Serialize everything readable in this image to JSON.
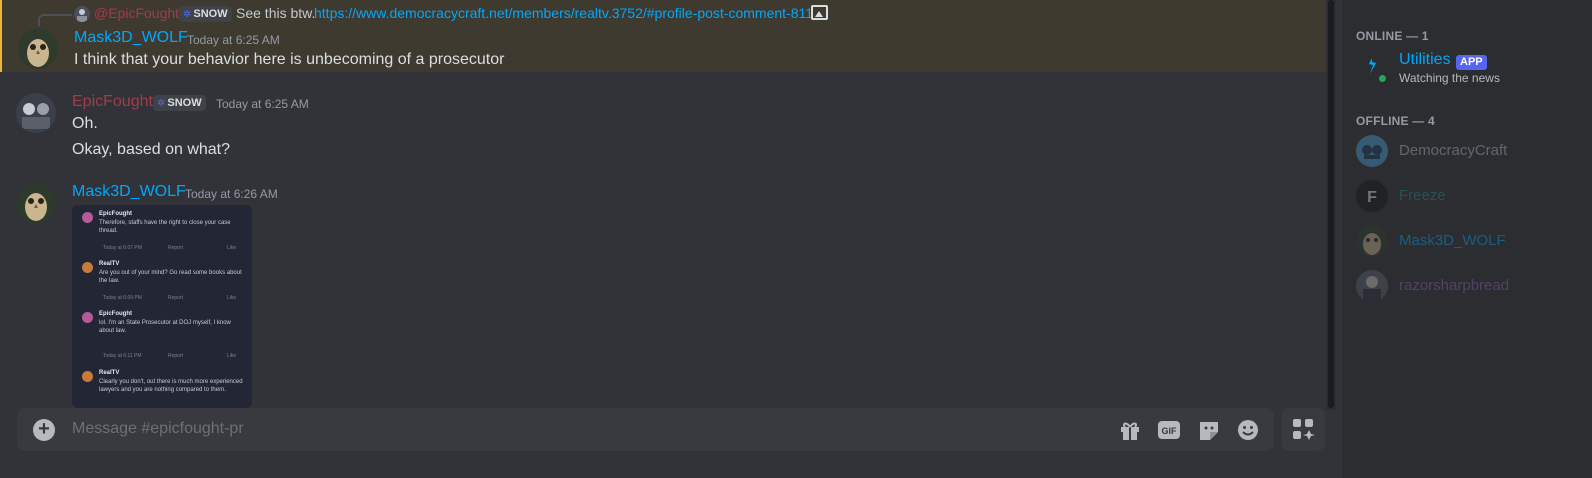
{
  "reply": {
    "author": "@EpicFought",
    "badge": "SNOW",
    "text": "See this btw.",
    "link": "https://www.democracycraft.net/members/realtv.3752/#profile-post-comment-811"
  },
  "messages": [
    {
      "author": "Mask3D_WOLF",
      "author_color": "#00a8fc",
      "timestamp": "Today at 6:25 AM",
      "lines": [
        "I think that your behavior here is unbecoming of a prosecutor"
      ]
    },
    {
      "author": "EpicFought",
      "author_color": "#a33b4a",
      "badge": "SNOW",
      "timestamp": "Today at 6:25 AM",
      "lines": [
        "Oh.",
        "Okay, based on what?"
      ]
    },
    {
      "author": "Mask3D_WOLF",
      "author_color": "#00a8fc",
      "timestamp": "Today at 6:26 AM",
      "lines": []
    }
  ],
  "embedded_image": {
    "posts": [
      {
        "name": "EpicFought",
        "text": "Therefore, staffs have the right to close your case thread.",
        "time": "Today at 6:07 PM",
        "report": "Report",
        "like": "Like"
      },
      {
        "name": "RealTV",
        "text": "Are you out of your mind? Go read some books about the law.",
        "time": "Today at 6:09 PM",
        "report": "Report",
        "like": "Like"
      },
      {
        "name": "EpicFought",
        "text": "lol. I'm an State Prosecutor at DOJ myself, I know about law.",
        "time": "Today at 6:11 PM",
        "report": "Report",
        "like": "Like"
      },
      {
        "name": "RealTV",
        "text": "Clearly you don't, out there is much more experienced lawyers and you are nothing compared to them.",
        "time": "",
        "report": "",
        "like": ""
      }
    ]
  },
  "composer": {
    "placeholder": "Message #epicfought-pr",
    "icons": [
      "gift-icon",
      "gif-icon",
      "sticker-icon",
      "emoji-icon",
      "apps-icon"
    ],
    "gif_label": "GIF"
  },
  "members": {
    "online_header": "ONLINE — 1",
    "offline_header": "OFFLINE — 4",
    "online": [
      {
        "name": "Utilities",
        "badge": "APP",
        "status": "Watching the news",
        "color": "#00a8fc"
      }
    ],
    "offline": [
      {
        "name": "DemocracyCraft",
        "color": "#b5bac1"
      },
      {
        "name": "Freeze",
        "color": "#1f8b8f"
      },
      {
        "name": "Mask3D_WOLF",
        "color": "#00a8fc"
      },
      {
        "name": "razorsharpbread",
        "color": "#8a5fb8"
      }
    ]
  }
}
